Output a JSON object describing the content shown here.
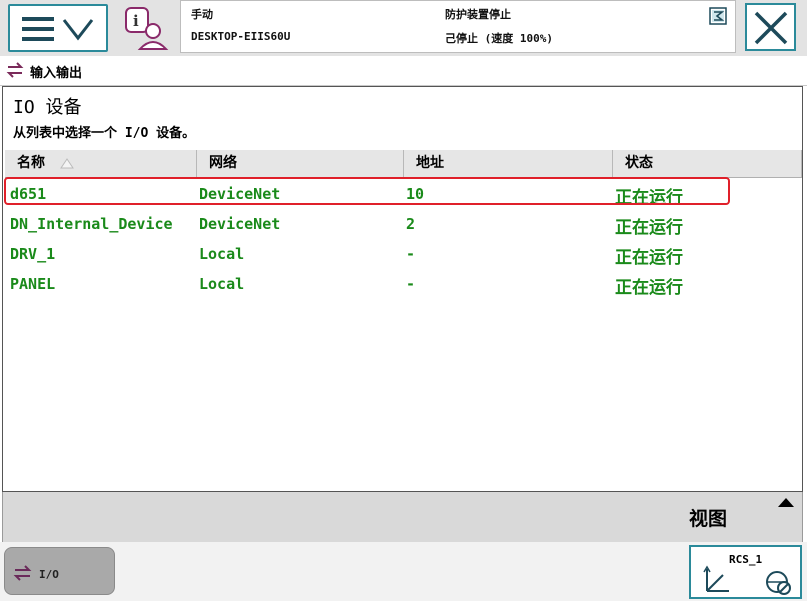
{
  "header": {
    "mode": "手动",
    "controller": "DESKTOP-EIIS60U",
    "safety_status": "防护装置停止",
    "run_status": "己停止 (速度 100%)"
  },
  "window": {
    "tab_label": "输入输出"
  },
  "page": {
    "title": "IO 设备",
    "subtitle": "从列表中选择一个 I/O 设备。"
  },
  "table": {
    "columns": [
      "名称",
      "网络",
      "地址",
      "状态"
    ],
    "rows": [
      {
        "name": "d651",
        "network": "DeviceNet",
        "address": "10",
        "status": "正在运行",
        "selected": true
      },
      {
        "name": "DN_Internal_Device",
        "network": "DeviceNet",
        "address": "2",
        "status": "正在运行",
        "selected": false
      },
      {
        "name": "DRV_1",
        "network": "Local",
        "address": "-",
        "status": "正在运行",
        "selected": false
      },
      {
        "name": "PANEL",
        "network": "Local",
        "address": "-",
        "status": "正在运行",
        "selected": false
      }
    ]
  },
  "toolbar": {
    "view_label": "视图"
  },
  "taskbar": {
    "io_label": "I/O",
    "rcs_label": "RCS_1"
  },
  "icons": {
    "menu": "menu-icon",
    "info": "info-user-icon",
    "close": "close-icon",
    "io": "io-arrows-icon",
    "sort": "sort-asc-icon",
    "view_arrow": "triangle-up-icon",
    "axes": "axes-icon",
    "jog": "jog-icon"
  },
  "colors": {
    "accent": "#2b8a9a",
    "running_text": "#1a8a1a",
    "selection_outline": "#e0202a"
  }
}
